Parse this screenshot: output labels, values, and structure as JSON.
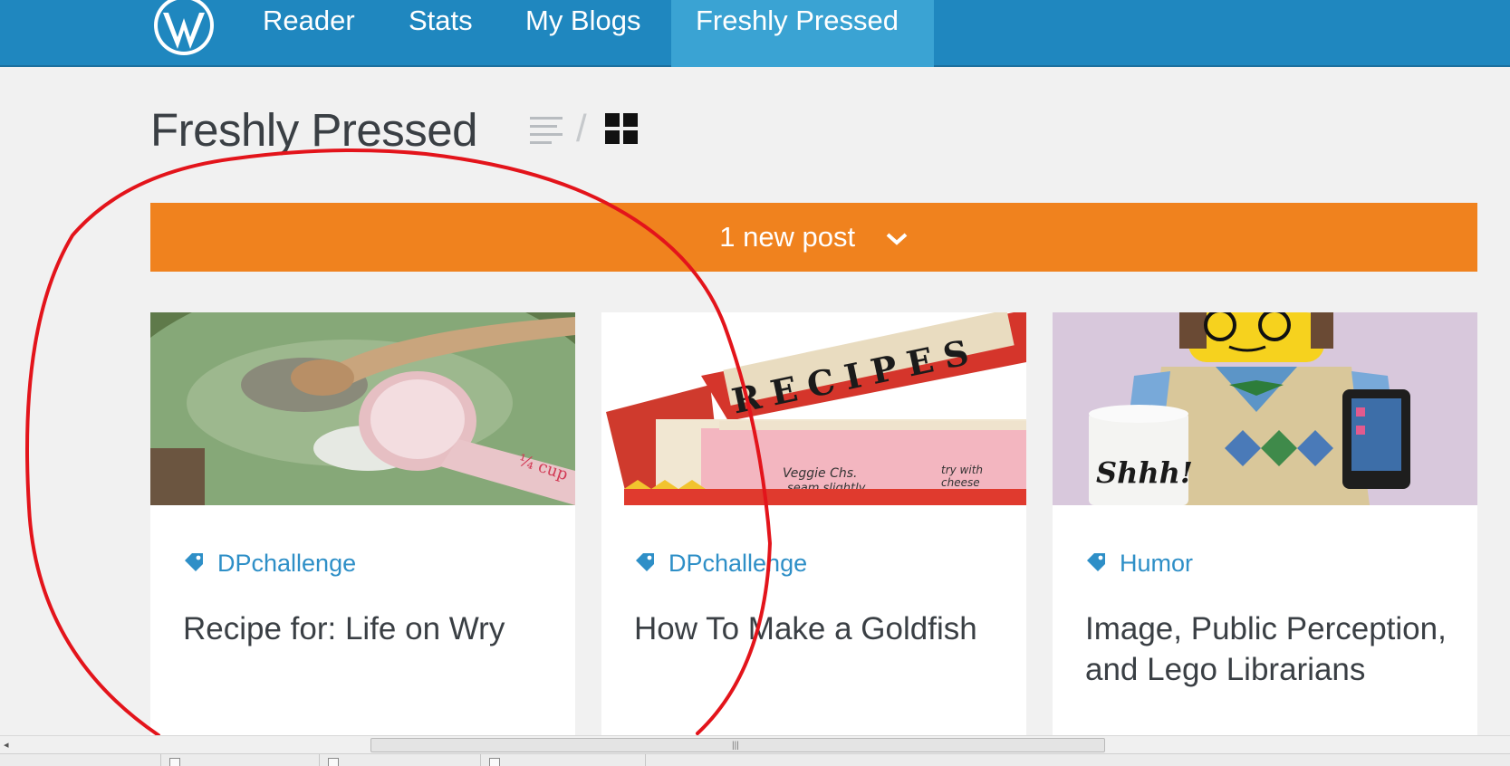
{
  "nav": {
    "logo": "wordpress-logo",
    "items": [
      {
        "label": "Reader"
      },
      {
        "label": "Stats"
      },
      {
        "label": "My Blogs"
      },
      {
        "label": "Freshly Pressed",
        "active": true
      }
    ],
    "bar_color": "#1f87bf",
    "active_color": "#3aa3d3"
  },
  "page": {
    "title": "Freshly Pressed",
    "view_toggle": {
      "list_icon": "list-view-icon",
      "grid_icon": "grid-view-icon",
      "separator": "/",
      "selected": "grid"
    }
  },
  "notice": {
    "text": "1 new post",
    "icon": "chevron-down-icon",
    "color": "#f0821e"
  },
  "cards": [
    {
      "tag": "DPchallenge",
      "title": "Recipe for: Life on Wry",
      "image": "measuring-cup-photo"
    },
    {
      "tag": "DPchallenge",
      "title": "How To Make a Goldfish",
      "image": "recipe-box-photo"
    },
    {
      "tag": "Humor",
      "title": "Image, Public Perception, and Lego Librarians",
      "image": "lego-librarian-photo"
    }
  ],
  "image_text": {
    "cup": "¼ cup",
    "recipes": "RECIPES",
    "card_left": "Veggie Chs.",
    "card_left2": "seam slightly",
    "card_right": "try with",
    "card_right2": "cheese",
    "mug": "Shhh!"
  },
  "tag_color": "#2e8fc7",
  "annotation_color": "#e3141b"
}
